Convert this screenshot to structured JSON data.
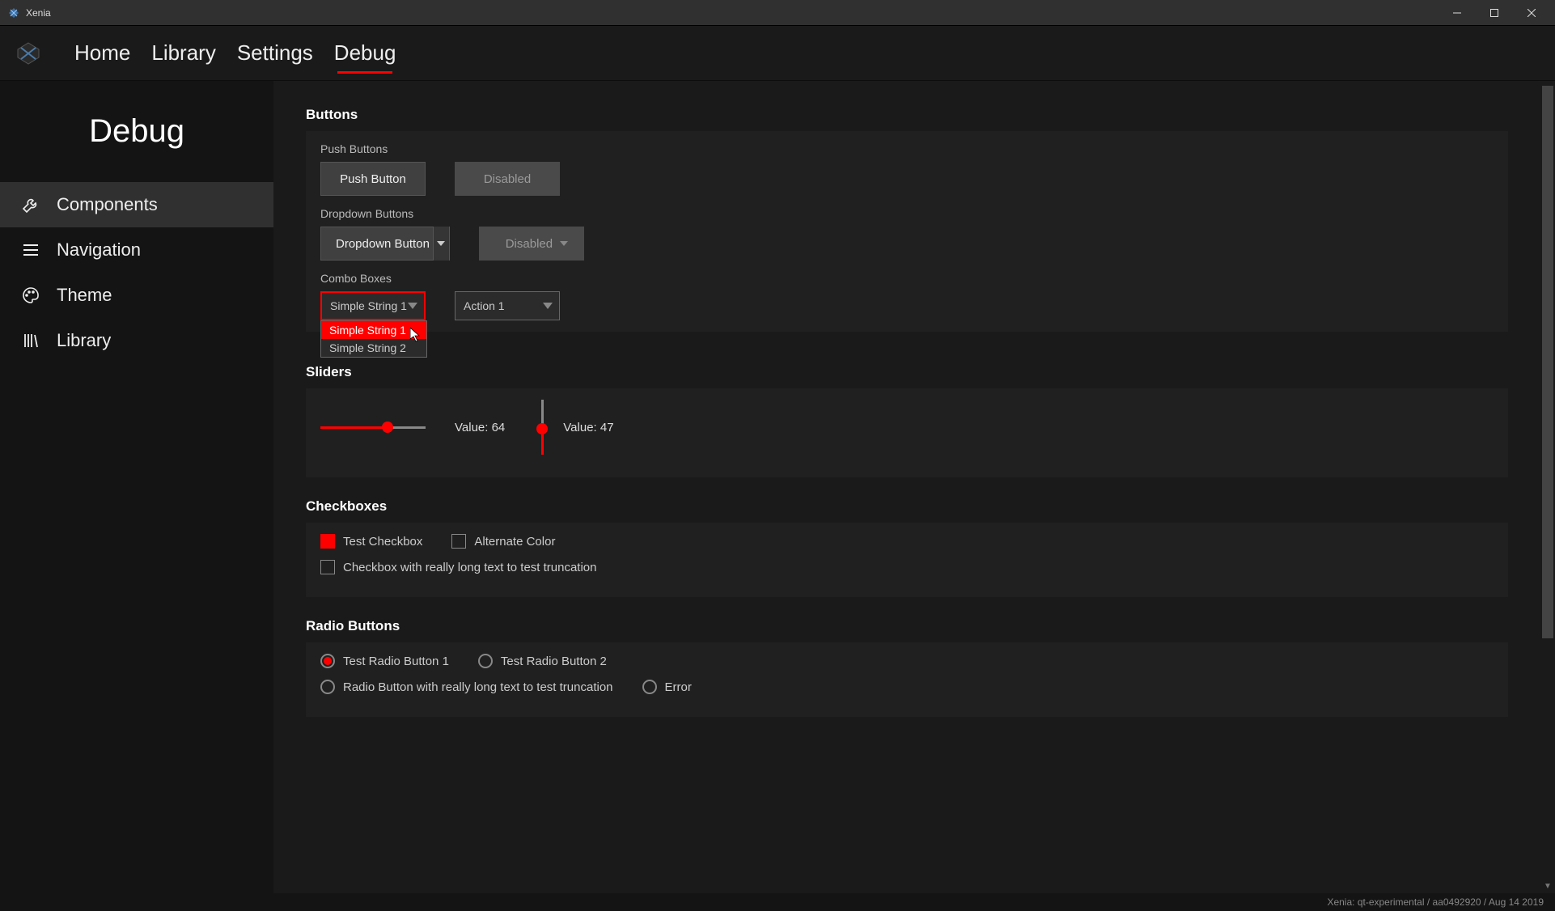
{
  "window": {
    "title": "Xenia"
  },
  "navbar": {
    "tabs": [
      "Home",
      "Library",
      "Settings",
      "Debug"
    ],
    "active_index": 3
  },
  "sidebar": {
    "title": "Debug",
    "items": [
      {
        "label": "Components",
        "icon": "wrench"
      },
      {
        "label": "Navigation",
        "icon": "menu"
      },
      {
        "label": "Theme",
        "icon": "palette"
      },
      {
        "label": "Library",
        "icon": "books"
      }
    ],
    "active_index": 0
  },
  "sections": {
    "buttons": {
      "title": "Buttons",
      "push_label": "Push Buttons",
      "push_button": "Push Button",
      "push_disabled": "Disabled",
      "dropdown_label": "Dropdown Buttons",
      "dropdown_button": "Dropdown Button",
      "dropdown_disabled": "Disabled",
      "combo_label": "Combo Boxes",
      "combo1_selected": "Simple String 1",
      "combo1_options": [
        "Simple String 1",
        "Simple String 2"
      ],
      "combo2_selected": "Action 1"
    },
    "sliders": {
      "title": "Sliders",
      "h_value": 64,
      "h_label": "Value: 64",
      "v_value": 47,
      "v_label": "Value: 47"
    },
    "checkboxes": {
      "title": "Checkboxes",
      "cb1": "Test Checkbox",
      "cb2": "Alternate Color",
      "cb3": "Checkbox with really long text to test truncation"
    },
    "radios": {
      "title": "Radio Buttons",
      "r1": "Test Radio Button 1",
      "r2": "Test Radio Button 2",
      "r3": "Radio Button with really long text to test truncation",
      "r4": "Error"
    }
  },
  "statusbar": "Xenia: qt-experimental / aa0492920 / Aug 14 2019",
  "colors": {
    "accent": "#ff0000",
    "bg": "#1a1a1a",
    "panel": "#202020"
  }
}
